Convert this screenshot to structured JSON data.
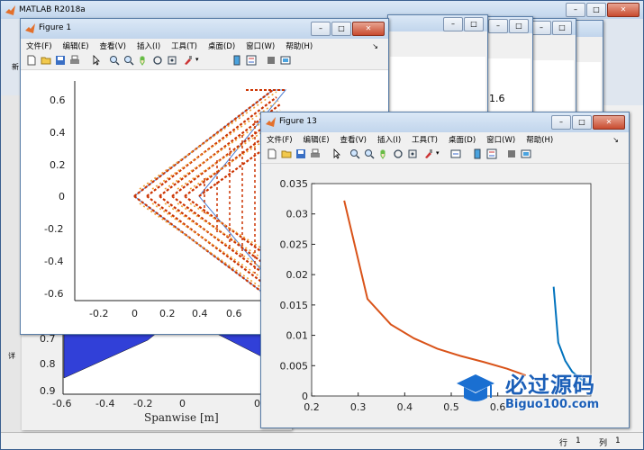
{
  "main_window": {
    "title": "MATLAB R2018a",
    "left_cut_label": "新",
    "side_labels": [
      "详"
    ]
  },
  "status": {
    "row_label": "行",
    "row_value": "1",
    "col_label": "列",
    "col_value": "1"
  },
  "background_figures": {
    "value_label": "1.6"
  },
  "menu": [
    "文件(F)",
    "编辑(E)",
    "查看(V)",
    "插入(I)",
    "工具(T)",
    "桌面(D)",
    "窗口(W)",
    "帮助(H)"
  ],
  "figure1": {
    "title": "Figure 1",
    "yticks": [
      "0.6",
      "0.4",
      "0.2",
      "0",
      "-0.2",
      "-0.4",
      "-0.6"
    ],
    "xticks": [
      "-0.2",
      "0",
      "0.2",
      "0.4",
      "0.6"
    ]
  },
  "figure_behind": {
    "yticks": [
      "0.7",
      "0.8",
      "0.9"
    ],
    "xticks": [
      "-0.6",
      "-0.4",
      "-0.2",
      "0",
      "0"
    ],
    "xlabel": "Spanwise [m]"
  },
  "figure13": {
    "title": "Figure 13",
    "chart_data": {
      "type": "line",
      "xlim": [
        0.2,
        0.8
      ],
      "ylim": [
        0,
        0.035
      ],
      "xticks": [
        "0.2",
        "0.3",
        "0.4",
        "0.5",
        "0.6"
      ],
      "yticks": [
        "0.035",
        "0.03",
        "0.025",
        "0.02",
        "0.015",
        "0.01",
        "0.005",
        "0"
      ],
      "series": [
        {
          "color": "#d95319",
          "x": [
            0.27,
            0.32,
            0.37,
            0.42,
            0.47,
            0.52,
            0.57,
            0.62,
            0.66
          ],
          "y": [
            0.0322,
            0.016,
            0.0118,
            0.0095,
            0.0078,
            0.0066,
            0.0056,
            0.0045,
            0.0034
          ]
        },
        {
          "color": "#0072bd",
          "x": [
            0.72,
            0.73,
            0.745,
            0.76,
            0.78,
            0.8
          ],
          "y": [
            0.018,
            0.0088,
            0.0058,
            0.004,
            0.0027,
            0.0018
          ]
        }
      ]
    }
  },
  "watermark": {
    "text": "必过源码",
    "url": "Biguo100.com"
  }
}
